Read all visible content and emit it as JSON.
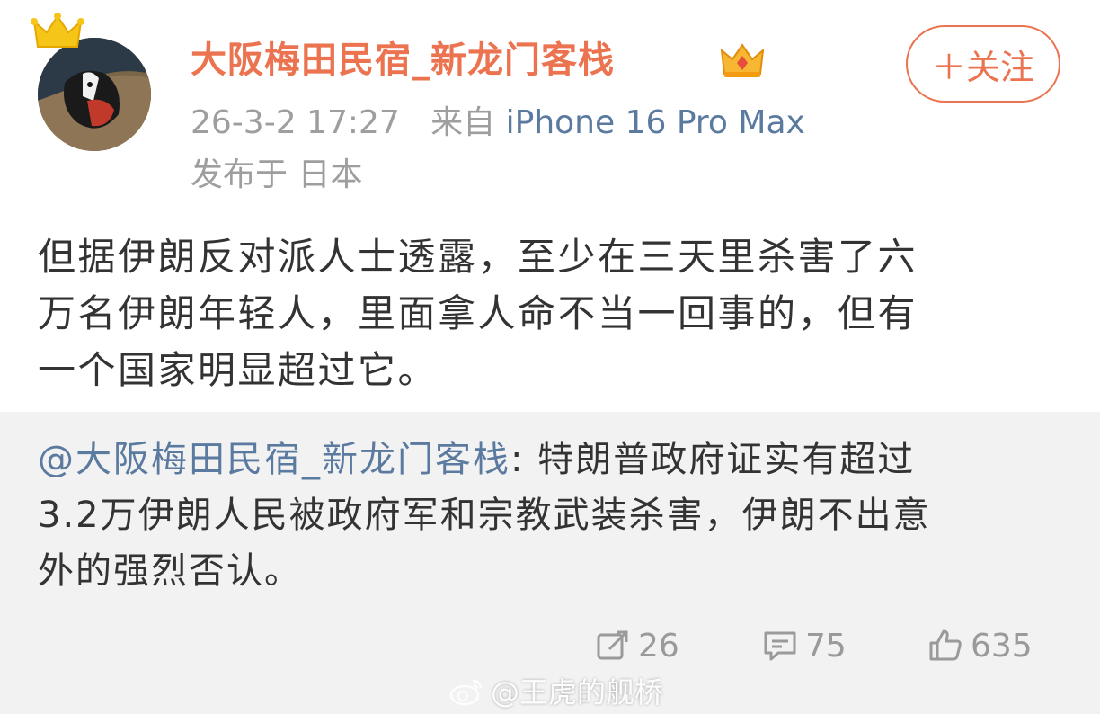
{
  "post": {
    "author": "大阪梅田民宿_新龙门客栈",
    "follow_label": "＋关注",
    "time": "26-3-2 17:27",
    "source_prefix": "来自",
    "device": "iPhone 16 Pro Max",
    "location": "发布于 日本",
    "body_lines": [
      "但据伊朗反对派人士透露，至少在三天里杀害了六",
      "万名伊朗年轻人，里面拿人命不当一回事的，但有",
      "一个国家明显超过它。"
    ]
  },
  "repost": {
    "mention": "@大阪梅田民宿_新龙门客栈",
    "line1_rest": ": 特朗普政府证实有超过",
    "line2": "3.2万伊朗人民被政府军和宗教武装杀害，伊朗不出意",
    "line3": "外的强烈否认。",
    "repost_count": "26",
    "comment_count": "75",
    "like_count": "635"
  },
  "watermark": "@王虎的舰桥",
  "colors": {
    "accent": "#eb7350",
    "link": "#5b7a9f",
    "muted": "#9e9e9e",
    "repost_bg": "#f2f2f2"
  },
  "icons": [
    "crown-icon",
    "vip-crown-icon",
    "repost-icon",
    "comment-icon",
    "like-icon",
    "weibo-logo-icon"
  ]
}
